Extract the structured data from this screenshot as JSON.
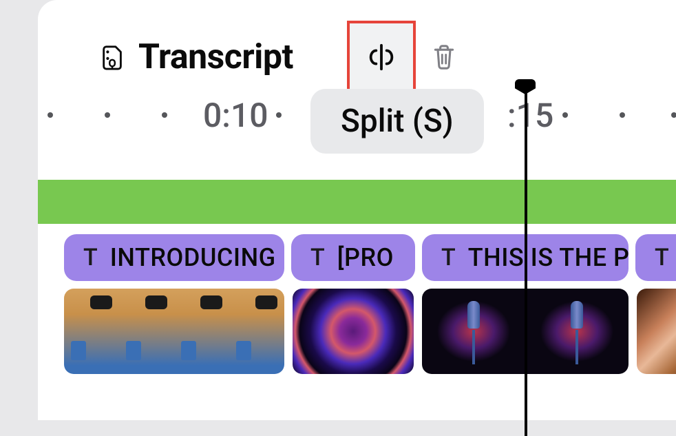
{
  "header": {
    "title": "Transcript",
    "split_tooltip": "Split (S)"
  },
  "timeline": {
    "labels": {
      "t10": "0:10",
      "t15": ":15"
    }
  },
  "text_clips": [
    {
      "label": "INTRODUCING"
    },
    {
      "label": "[PRO"
    },
    {
      "label": "THIS IS THE P"
    },
    {
      "label": ""
    }
  ],
  "colors": {
    "highlight_border": "#e6443a",
    "text_clip_bg": "#9d84e8",
    "green_track": "#78c850"
  }
}
